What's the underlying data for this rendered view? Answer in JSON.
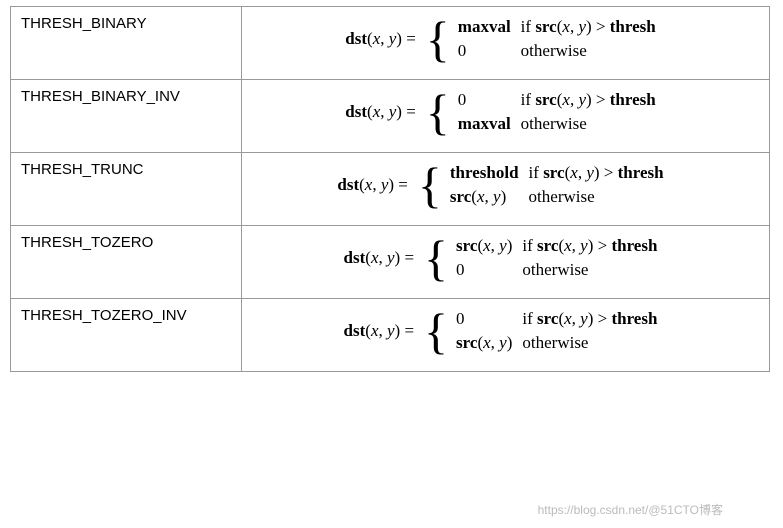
{
  "rows": [
    {
      "name": "THRESH_BINARY",
      "case1_val": "maxval",
      "case2_val": "0"
    },
    {
      "name": "THRESH_BINARY_INV",
      "case1_val": "0",
      "case2_val": "maxval"
    },
    {
      "name": "THRESH_TRUNC",
      "case1_val": "threshold",
      "case2_val": "src(x, y)"
    },
    {
      "name": "THRESH_TOZERO",
      "case1_val": "src(x, y)",
      "case2_val": "0"
    },
    {
      "name": "THRESH_TOZERO_INV",
      "case1_val": "0",
      "case2_val": "src(x, y)"
    }
  ],
  "common": {
    "lhs_fn": "dst",
    "args": "(x, y)",
    "eq": " = ",
    "cond_if": "if ",
    "cond_src": "src",
    "cond_args": "(x, y)",
    "cond_gt": " > ",
    "cond_thresh": "thresh",
    "otherwise": "otherwise"
  },
  "val_bold": {
    "maxval": true,
    "0": false,
    "threshold": true,
    "src(x, y)": true
  },
  "watermark": "https://blog.csdn.net/@51CTO博客"
}
